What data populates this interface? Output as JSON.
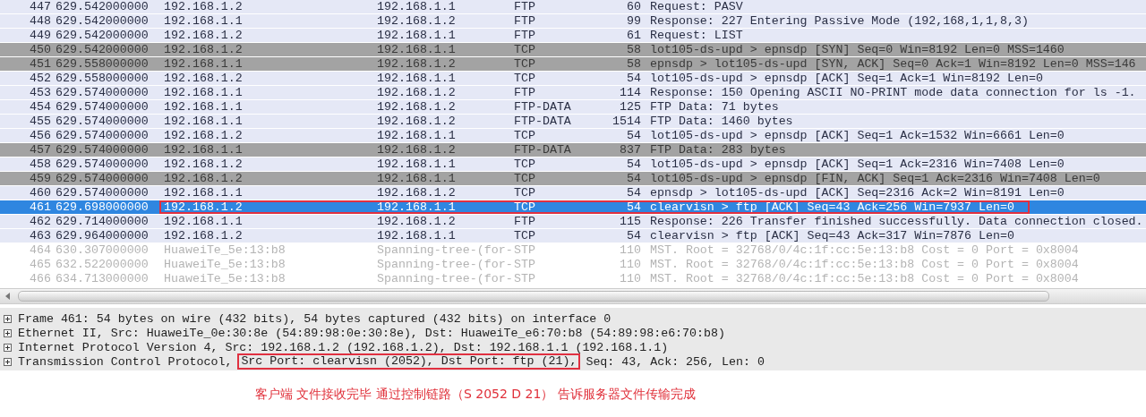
{
  "packets": [
    {
      "no": "447",
      "time": "629.542000000",
      "source": "192.168.1.2",
      "destination": "192.168.1.1",
      "protocol": "FTP",
      "length": "60",
      "info": "Request: PASV",
      "kind": "normal",
      "selected": false,
      "boxed": false
    },
    {
      "no": "448",
      "time": "629.542000000",
      "source": "192.168.1.1",
      "destination": "192.168.1.2",
      "protocol": "FTP",
      "length": "99",
      "info": "Response: 227 Entering Passive Mode (192,168,1,1,8,3)",
      "kind": "normal",
      "selected": false,
      "boxed": false
    },
    {
      "no": "449",
      "time": "629.542000000",
      "source": "192.168.1.2",
      "destination": "192.168.1.1",
      "protocol": "FTP",
      "length": "61",
      "info": "Request: LIST",
      "kind": "normal",
      "selected": false,
      "boxed": false
    },
    {
      "no": "450",
      "time": "629.542000000",
      "source": "192.168.1.2",
      "destination": "192.168.1.1",
      "protocol": "TCP",
      "length": "58",
      "info": "lot105-ds-upd > epnsdp [SYN] Seq=0 Win=8192 Len=0 MSS=1460",
      "kind": "gray",
      "selected": false,
      "boxed": false
    },
    {
      "no": "451",
      "time": "629.558000000",
      "source": "192.168.1.1",
      "destination": "192.168.1.2",
      "protocol": "TCP",
      "length": "58",
      "info": "epnsdp > lot105-ds-upd [SYN, ACK] Seq=0 Ack=1 Win=8192 Len=0 MSS=146",
      "kind": "gray",
      "selected": false,
      "boxed": false
    },
    {
      "no": "452",
      "time": "629.558000000",
      "source": "192.168.1.2",
      "destination": "192.168.1.1",
      "protocol": "TCP",
      "length": "54",
      "info": "lot105-ds-upd > epnsdp [ACK] Seq=1 Ack=1 Win=8192 Len=0",
      "kind": "normal",
      "selected": false,
      "boxed": false
    },
    {
      "no": "453",
      "time": "629.574000000",
      "source": "192.168.1.1",
      "destination": "192.168.1.2",
      "protocol": "FTP",
      "length": "114",
      "info": "Response: 150 Opening ASCII NO-PRINT mode data connection for ls -1.",
      "kind": "normal",
      "selected": false,
      "boxed": false
    },
    {
      "no": "454",
      "time": "629.574000000",
      "source": "192.168.1.1",
      "destination": "192.168.1.2",
      "protocol": "FTP-DATA",
      "length": "125",
      "info": "FTP Data: 71 bytes",
      "kind": "normal",
      "selected": false,
      "boxed": false
    },
    {
      "no": "455",
      "time": "629.574000000",
      "source": "192.168.1.1",
      "destination": "192.168.1.2",
      "protocol": "FTP-DATA",
      "length": "1514",
      "info": "FTP Data: 1460 bytes",
      "kind": "normal",
      "selected": false,
      "boxed": false
    },
    {
      "no": "456",
      "time": "629.574000000",
      "source": "192.168.1.2",
      "destination": "192.168.1.1",
      "protocol": "TCP",
      "length": "54",
      "info": "lot105-ds-upd > epnsdp [ACK] Seq=1 Ack=1532 Win=6661 Len=0",
      "kind": "normal",
      "selected": false,
      "boxed": false
    },
    {
      "no": "457",
      "time": "629.574000000",
      "source": "192.168.1.1",
      "destination": "192.168.1.2",
      "protocol": "FTP-DATA",
      "length": "837",
      "info": "FTP Data: 283 bytes",
      "kind": "gray",
      "selected": false,
      "boxed": false
    },
    {
      "no": "458",
      "time": "629.574000000",
      "source": "192.168.1.2",
      "destination": "192.168.1.1",
      "protocol": "TCP",
      "length": "54",
      "info": "lot105-ds-upd > epnsdp [ACK] Seq=1 Ack=2316 Win=7408 Len=0",
      "kind": "normal",
      "selected": false,
      "boxed": false
    },
    {
      "no": "459",
      "time": "629.574000000",
      "source": "192.168.1.2",
      "destination": "192.168.1.1",
      "protocol": "TCP",
      "length": "54",
      "info": "lot105-ds-upd > epnsdp [FIN, ACK] Seq=1 Ack=2316 Win=7408 Len=0",
      "kind": "gray",
      "selected": false,
      "boxed": false
    },
    {
      "no": "460",
      "time": "629.574000000",
      "source": "192.168.1.1",
      "destination": "192.168.1.2",
      "protocol": "TCP",
      "length": "54",
      "info": "epnsdp > lot105-ds-upd [ACK] Seq=2316 Ack=2 Win=8191 Len=0",
      "kind": "normal",
      "selected": false,
      "boxed": false
    },
    {
      "no": "461",
      "time": "629.698000000",
      "source": "192.168.1.2",
      "destination": "192.168.1.1",
      "protocol": "TCP",
      "length": "54",
      "info": "clearvisn > ftp [ACK] Seq=43 Ack=256 Win=7937 Len=0",
      "kind": "normal",
      "selected": true,
      "boxed": true
    },
    {
      "no": "462",
      "time": "629.714000000",
      "source": "192.168.1.1",
      "destination": "192.168.1.2",
      "protocol": "FTP",
      "length": "115",
      "info": "Response: 226 Transfer finished successfully. Data connection closed.",
      "kind": "normal",
      "selected": false,
      "boxed": false
    },
    {
      "no": "463",
      "time": "629.964000000",
      "source": "192.168.1.2",
      "destination": "192.168.1.1",
      "protocol": "TCP",
      "length": "54",
      "info": "clearvisn > ftp [ACK] Seq=43 Ack=317 Win=7876 Len=0",
      "kind": "normal",
      "selected": false,
      "boxed": false
    },
    {
      "no": "464",
      "time": "630.307000000",
      "source": "HuaweiTe_5e:13:b8",
      "destination": "Spanning-tree-(for-",
      "protocol": "STP",
      "length": "110",
      "info": "MST. Root = 32768/0/4c:1f:cc:5e:13:b8  Cost = 0  Port = 0x8004",
      "kind": "faded",
      "selected": false,
      "boxed": false
    },
    {
      "no": "465",
      "time": "632.522000000",
      "source": "HuaweiTe_5e:13:b8",
      "destination": "Spanning-tree-(for-",
      "protocol": "STP",
      "length": "110",
      "info": "MST. Root = 32768/0/4c:1f:cc:5e:13:b8  Cost = 0  Port = 0x8004",
      "kind": "faded",
      "selected": false,
      "boxed": false
    },
    {
      "no": "466",
      "time": "634.713000000",
      "source": "HuaweiTe_5e:13:b8",
      "destination": "Spanning-tree-(for-",
      "protocol": "STP",
      "length": "110",
      "info": "MST. Root = 32768/0/4c:1f:cc:5e:13:b8  Cost = 0  Port = 0x8004",
      "kind": "faded",
      "selected": false,
      "boxed": false
    }
  ],
  "details": [
    {
      "segments": [
        {
          "text": "Frame 461: 54 bytes on wire (432 bits), 54 bytes captured (432 bits) on interface 0",
          "boxed": false
        }
      ]
    },
    {
      "segments": [
        {
          "text": "Ethernet II, Src: HuaweiTe_0e:30:8e (54:89:98:0e:30:8e), Dst: HuaweiTe_e6:70:b8 (54:89:98:e6:70:b8)",
          "boxed": false
        }
      ]
    },
    {
      "segments": [
        {
          "text": "Internet Protocol Version 4, Src: 192.168.1.2 (192.168.1.2), Dst: 192.168.1.1 (192.168.1.1)",
          "boxed": false
        }
      ]
    },
    {
      "segments": [
        {
          "text": "Transmission Control Protocol, ",
          "boxed": false
        },
        {
          "text": "Src Port: clearvisn (2052), Dst Port: ftp (21),",
          "boxed": true
        },
        {
          "text": " Seq: 43, Ack: 256, Len: 0",
          "boxed": false
        }
      ]
    }
  ],
  "annotation": "客户端 文件接收完毕 通过控制链路（S 2052 D 21） 告诉服务器文件传输完成"
}
